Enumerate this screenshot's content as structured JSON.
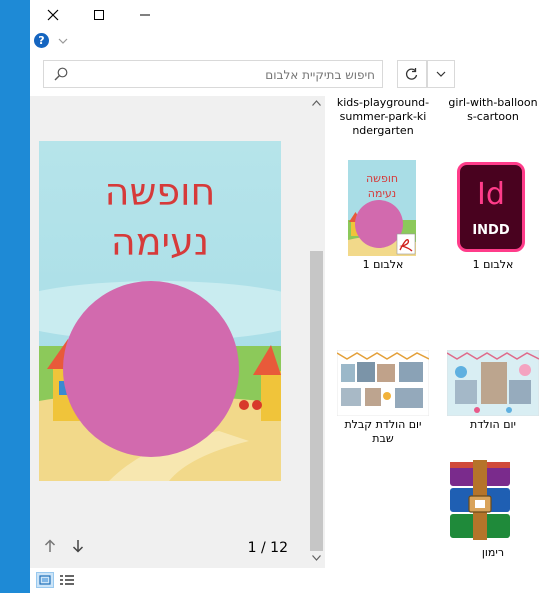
{
  "window": {
    "min_glyph": "—",
    "max_glyph": "☐",
    "close_glyph": "✕"
  },
  "search": {
    "placeholder": "חיפוש בתיקיית אלבום"
  },
  "preview": {
    "title_line1": "חופשה",
    "title_line2": "נעימה",
    "page_indicator": "1 / 12"
  },
  "files": [
    {
      "name": "kids-playground-summer-park-kindergarten",
      "lines": [
        "kids-playground-",
        "summer-park-ki",
        "ndergarten"
      ],
      "type": "png"
    },
    {
      "name": "girl-with-balloons-cartoon",
      "lines": [
        "girl-with-balloon",
        "s-cartoon"
      ],
      "type": "png"
    },
    {
      "name": "אלבום 1",
      "type": "pdf"
    },
    {
      "name": "אלבום 1",
      "type": "indd",
      "icon_text_big": "Id",
      "icon_text_small": "INDD"
    },
    {
      "name": "יום הולדת קבלת שבת",
      "lines": [
        "יום הולדת קבלת",
        "שבת"
      ],
      "type": "image"
    },
    {
      "name": "יום הולדת",
      "type": "image"
    },
    {
      "name": "רימון",
      "type": "rar"
    }
  ],
  "colors": {
    "accent": "#1e8ad6",
    "indd_border": "#ff3c8a",
    "indd_bg": "#49021f",
    "pink_circle": "#d26aae"
  }
}
